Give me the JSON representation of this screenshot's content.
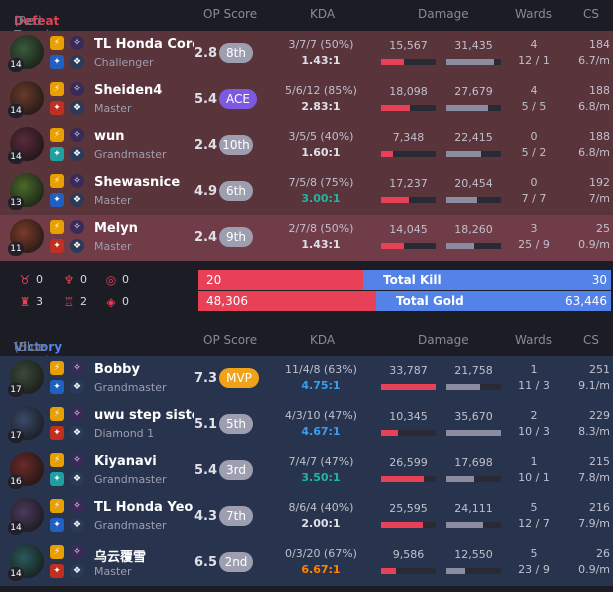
{
  "colors": {
    "defeat": "#e84057",
    "victory": "#5383e8",
    "ace": "#7b59e0",
    "mvp": "#f0a218"
  },
  "headers": {
    "op": "OP Score",
    "kda": "KDA",
    "damage": "Damage",
    "wards": "Wards",
    "cs": "CS"
  },
  "red": {
    "result": "Defeat",
    "label": "(Red Team)",
    "players": [
      {
        "name": "TL Honda Core...",
        "tier": "Challenger",
        "level": "14",
        "op": "2.8",
        "rank": "8th",
        "kda": "3/7/7 (50%)",
        "ratio": "1.43:1",
        "dmg": "15,567",
        "taken": "31,435",
        "dealt_frac": 0.42,
        "taken_frac": 0.88,
        "wards": "4",
        "wards2": "12 / 1",
        "cs": "184",
        "csm": "6.7/m"
      },
      {
        "name": "Sheiden4",
        "tier": "Master",
        "level": "14",
        "op": "5.4",
        "rank": "ACE",
        "kda": "5/6/12 (85%)",
        "ratio": "2.83:1",
        "dmg": "18,098",
        "taken": "27,679",
        "dealt_frac": 0.53,
        "taken_frac": 0.77,
        "wards": "4",
        "wards2": "5 / 5",
        "cs": "188",
        "csm": "6.8/m"
      },
      {
        "name": "wun",
        "tier": "Grandmaster",
        "level": "14",
        "op": "2.4",
        "rank": "10th",
        "kda": "3/5/5 (40%)",
        "ratio": "1.60:1",
        "dmg": "7,348",
        "taken": "22,415",
        "dealt_frac": 0.22,
        "taken_frac": 0.63,
        "wards": "0",
        "wards2": "5 / 2",
        "cs": "188",
        "csm": "6.8/m"
      },
      {
        "name": "Shewasnice",
        "tier": "Master",
        "level": "13",
        "op": "4.9",
        "rank": "6th",
        "kda": "7/5/8 (75%)",
        "ratio": "3.00:1",
        "dmg": "17,237",
        "taken": "20,454",
        "dealt_frac": 0.51,
        "taken_frac": 0.57,
        "wards": "0",
        "wards2": "7 / 7",
        "cs": "192",
        "csm": "7/m"
      },
      {
        "name": "Melyn",
        "tier": "Master",
        "level": "11",
        "op": "2.4",
        "rank": "9th",
        "kda": "2/7/8 (50%)",
        "ratio": "1.43:1",
        "dmg": "14,045",
        "taken": "18,260",
        "dealt_frac": 0.41,
        "taken_frac": 0.51,
        "wards": "3",
        "wards2": "25 / 9",
        "cs": "25",
        "csm": "0.9/m"
      }
    ]
  },
  "objectives": {
    "baron": "0",
    "dragon": "0",
    "herald": "0",
    "tower": "3",
    "inhib": "2",
    "void": "0"
  },
  "totals": {
    "kill_label": "Total Kill",
    "kill_red": "20",
    "kill_blue": "30",
    "gold_label": "Total Gold",
    "gold_red": "48,306",
    "gold_blue": "63,446",
    "kill_red_frac": 0.4,
    "gold_red_frac": 0.432
  },
  "blue": {
    "result": "Victory",
    "label": "(Blue Team)",
    "players": [
      {
        "name": "Bobby",
        "tier": "Grandmaster",
        "level": "17",
        "op": "7.3",
        "rank": "MVP",
        "kda": "11/4/8 (63%)",
        "ratio": "4.75:1",
        "dmg": "33,787",
        "taken": "21,758",
        "dealt_frac": 1.0,
        "taken_frac": 0.61,
        "wards": "1",
        "wards2": "11 / 3",
        "cs": "251",
        "csm": "9.1/m"
      },
      {
        "name": "uwu step sister",
        "tier": "Diamond 1",
        "level": "17",
        "op": "5.1",
        "rank": "5th",
        "kda": "4/3/10 (47%)",
        "ratio": "4.67:1",
        "dmg": "10,345",
        "taken": "35,670",
        "dealt_frac": 0.31,
        "taken_frac": 1.0,
        "wards": "2",
        "wards2": "10 / 3",
        "cs": "229",
        "csm": "8.3/m"
      },
      {
        "name": "Kiyanavi",
        "tier": "Grandmaster",
        "level": "16",
        "op": "5.4",
        "rank": "3rd",
        "kda": "7/4/7 (47%)",
        "ratio": "3.50:1",
        "dmg": "26,599",
        "taken": "17,698",
        "dealt_frac": 0.79,
        "taken_frac": 0.5,
        "wards": "1",
        "wards2": "10 / 1",
        "cs": "215",
        "csm": "7.8/m"
      },
      {
        "name": "TL Honda Yeon",
        "tier": "Grandmaster",
        "level": "14",
        "op": "4.3",
        "rank": "7th",
        "kda": "8/6/4 (40%)",
        "ratio": "2.00:1",
        "dmg": "25,595",
        "taken": "24,111",
        "dealt_frac": 0.76,
        "taken_frac": 0.68,
        "wards": "5",
        "wards2": "12 / 7",
        "cs": "216",
        "csm": "7.9/m"
      },
      {
        "name": "乌云覆雪",
        "tier": "Master",
        "level": "14",
        "op": "6.5",
        "rank": "2nd",
        "kda": "0/3/20 (67%)",
        "ratio": "6.67:1",
        "dmg": "9,586",
        "taken": "12,550",
        "dealt_frac": 0.28,
        "taken_frac": 0.35,
        "wards": "5",
        "wards2": "23 / 9",
        "cs": "26",
        "csm": "0.9/m"
      }
    ]
  }
}
